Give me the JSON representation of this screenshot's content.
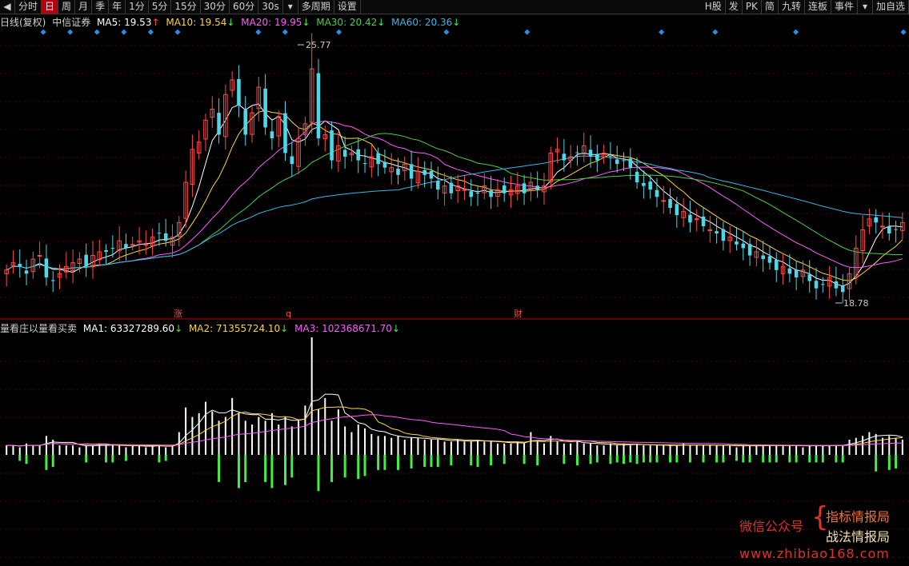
{
  "toolbar": {
    "items": [
      "分时",
      "日",
      "周",
      "月",
      "季",
      "年",
      "1分",
      "5分",
      "15分",
      "30分",
      "60分",
      "30s",
      "多周期",
      "设置"
    ],
    "active": "日",
    "right_items": [
      "H股",
      "发",
      "PK",
      "简",
      "九转",
      "连板",
      "事件",
      "加自选"
    ]
  },
  "price_panel": {
    "title": "日线(复权)",
    "stock_name": "中信证券",
    "ma": [
      {
        "label": "MA5: 19.53",
        "arrow": "↑",
        "color": "#ffffff"
      },
      {
        "label": "MA10: 19.54",
        "arrow": "↓",
        "color": "#ffd43b"
      },
      {
        "label": "MA20: 19.95",
        "arrow": "↓",
        "color": "#ff5cff"
      },
      {
        "label": "MA30: 20.42",
        "arrow": "↓",
        "color": "#48d048"
      },
      {
        "label": "MA60: 20.36",
        "arrow": "↓",
        "color": "#38b8e8"
      }
    ],
    "high_label": "25.77",
    "low_label": "18.78",
    "event_markers": [
      "涨",
      "q",
      "财"
    ]
  },
  "volume_panel": {
    "title": "量看庄以量看买卖",
    "ma": [
      {
        "label": "MA1: 63327289.60",
        "arrow": "↓",
        "color": "#ffffff"
      },
      {
        "label": "MA2: 71355724.10",
        "arrow": "↓",
        "color": "#ffd43b"
      },
      {
        "label": "MA3: 102368671.70",
        "arrow": "↓",
        "color": "#ff5cff"
      }
    ]
  },
  "colors": {
    "up": "#ff4a4a",
    "down": "#4fd7e8",
    "buy_bar": "#ffffff",
    "sell_bar": "#44ee44"
  },
  "watermark": {
    "line1": "微信公众号",
    "line2": "指标情报局",
    "line3": "战法情报局",
    "url": "www.zhibiao168.com"
  },
  "chart_data": {
    "type": "candlestick",
    "low": 18.78,
    "high": 25.77,
    "closes": [
      19.5,
      19.7,
      19.6,
      19.4,
      19.8,
      19.9,
      19.3,
      19.2,
      19.4,
      19.6,
      19.7,
      19.8,
      19.6,
      19.9,
      20.0,
      20.0,
      20.1,
      20.3,
      20.1,
      20.2,
      20.3,
      20.2,
      20.4,
      20.5,
      20.3,
      20.4,
      20.8,
      21.9,
      22.8,
      23.0,
      23.6,
      23.9,
      23.2,
      24.3,
      24.7,
      24.0,
      23.2,
      23.8,
      24.5,
      23.4,
      23.1,
      23.7,
      22.7,
      22.4,
      23.1,
      23.5,
      25.0,
      23.1,
      23.2,
      22.5,
      22.9,
      22.6,
      22.7,
      22.5,
      22.4,
      22.6,
      22.4,
      22.3,
      22.3,
      22.1,
      22.4,
      22.0,
      22.2,
      22.1,
      22.0,
      21.7,
      21.8,
      21.6,
      21.8,
      21.7,
      21.5,
      21.6,
      21.8,
      21.5,
      21.7,
      21.6,
      21.7,
      21.8,
      21.6,
      21.9,
      21.7,
      21.8,
      22.7,
      22.8,
      22.5,
      22.6,
      22.7,
      22.9,
      22.6,
      22.5,
      22.7,
      22.6,
      22.4,
      22.5,
      22.3,
      21.9,
      21.8,
      21.7,
      21.5,
      21.4,
      21.2,
      21.0,
      21.1,
      20.8,
      20.9,
      20.7,
      20.6,
      20.5,
      20.3,
      20.4,
      20.2,
      20.1,
      19.9,
      20.0,
      19.8,
      19.7,
      19.5,
      19.6,
      19.4,
      19.3,
      19.5,
      19.2,
      19.0,
      19.1,
      19.3,
      19.0,
      18.9,
      19.4,
      20.1,
      20.6,
      20.9,
      20.8,
      20.7,
      20.5,
      20.6,
      20.8
    ],
    "volumes": [
      5,
      5,
      4,
      6,
      5,
      5,
      10,
      8,
      5,
      5,
      5,
      4,
      5,
      5,
      6,
      5,
      5,
      5,
      4,
      5,
      5,
      4,
      5,
      5,
      4,
      5,
      12,
      25,
      20,
      22,
      28,
      23,
      18,
      20,
      30,
      22,
      18,
      16,
      20,
      18,
      22,
      16,
      20,
      15,
      18,
      26,
      62,
      24,
      30,
      18,
      24,
      15,
      12,
      16,
      14,
      11,
      10,
      10,
      9,
      10,
      8,
      9,
      9,
      8,
      8,
      8,
      7,
      7,
      8,
      7,
      7,
      8,
      7,
      7,
      6,
      6,
      6,
      7,
      6,
      12,
      7,
      6,
      10,
      7,
      6,
      6,
      7,
      6,
      6,
      5,
      5,
      6,
      5,
      6,
      5,
      6,
      5,
      5,
      5,
      5,
      5,
      5,
      6,
      5,
      5,
      5,
      5,
      5,
      5,
      5,
      4,
      5,
      5,
      5,
      5,
      5,
      5,
      5,
      5,
      5,
      4,
      5,
      5,
      5,
      5,
      5,
      5,
      8,
      9,
      10,
      12,
      11,
      9,
      10,
      9,
      8
    ],
    "ma": [
      {
        "name": "MA5",
        "value": 19.53
      },
      {
        "name": "MA10",
        "value": 19.54
      },
      {
        "name": "MA20",
        "value": 19.95
      },
      {
        "name": "MA30",
        "value": 20.42
      },
      {
        "name": "MA60",
        "value": 20.36
      }
    ]
  }
}
